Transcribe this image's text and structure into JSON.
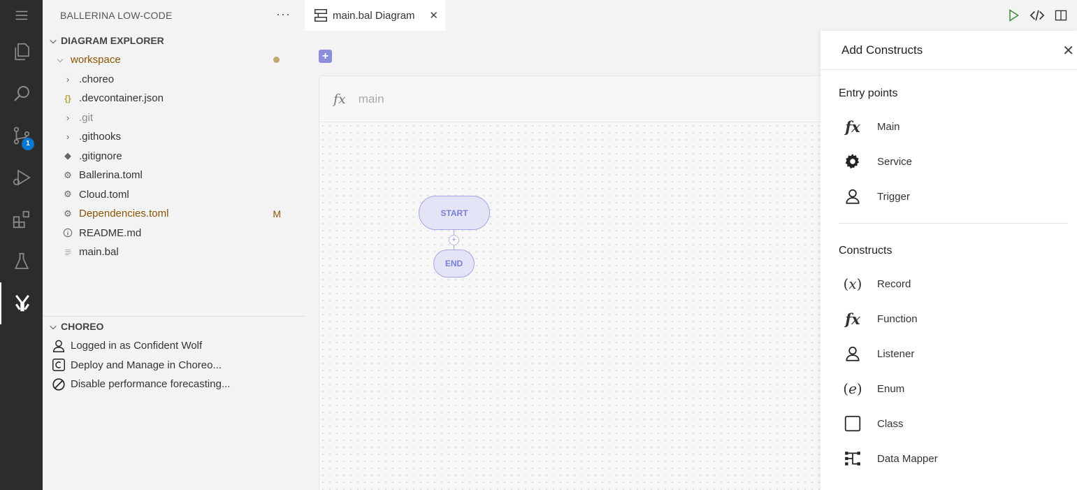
{
  "sidebar": {
    "title": "BALLERINA LOW-CODE",
    "more": "···",
    "explorer_title": "DIAGRAM EXPLORER",
    "workspace": "workspace",
    "files": [
      {
        "name": ".choreo",
        "type": "folder"
      },
      {
        "name": ".devcontainer.json",
        "type": "json"
      },
      {
        "name": ".git",
        "type": "folder"
      },
      {
        "name": ".githooks",
        "type": "folder"
      },
      {
        "name": ".gitignore",
        "type": "git"
      },
      {
        "name": "Ballerina.toml",
        "type": "settings"
      },
      {
        "name": "Cloud.toml",
        "type": "settings"
      },
      {
        "name": "Dependencies.toml",
        "type": "settings",
        "status": "M"
      },
      {
        "name": "README.md",
        "type": "info"
      },
      {
        "name": "main.bal",
        "type": "text"
      }
    ],
    "choreo_title": "CHOREO",
    "choreo_items": [
      "Logged in as Confident Wolf",
      "Deploy and Manage in Choreo...",
      "Disable performance forecasting..."
    ]
  },
  "activity": {
    "badge": "1"
  },
  "tab": {
    "label": "main.bal Diagram",
    "close": "✕"
  },
  "diagram": {
    "add": "+",
    "fx": "fx",
    "function_name": "main",
    "start": "START",
    "end": "END",
    "plus": "+"
  },
  "panel": {
    "title": "Add Constructs",
    "close": "✕",
    "entry_title": "Entry points",
    "entry_items": [
      "Main",
      "Service",
      "Trigger"
    ],
    "constructs_title": "Constructs",
    "construct_items": [
      "Record",
      "Function",
      "Listener",
      "Enum",
      "Class",
      "Data Mapper"
    ]
  },
  "colors": {
    "accent": "#8c8edb",
    "badge": "#0078d4",
    "modified": "#895503",
    "run": "#388a34"
  }
}
